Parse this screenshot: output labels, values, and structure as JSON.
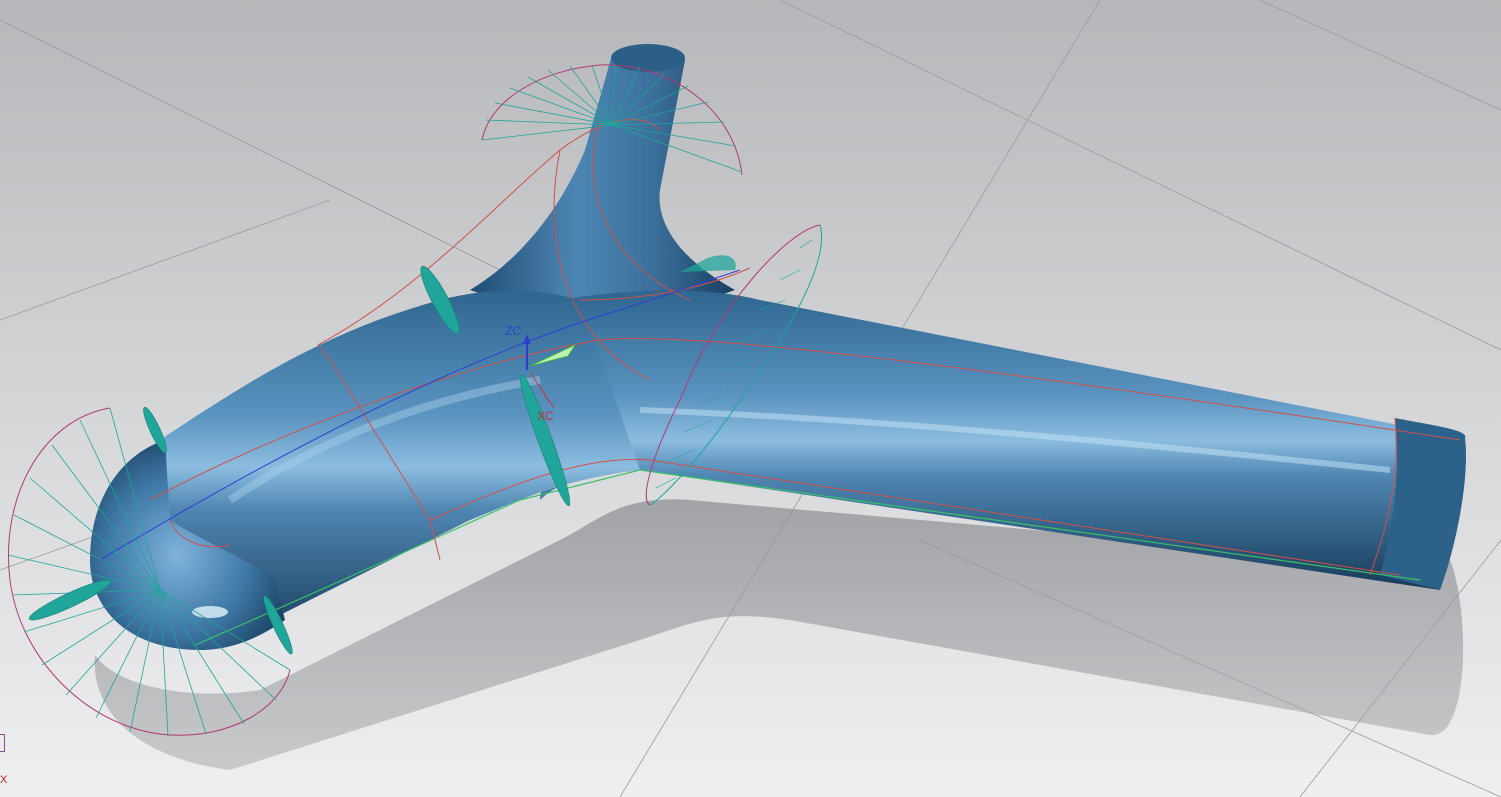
{
  "viewport": {
    "wcs_axes": {
      "zc_label": "ZC",
      "xc_label": "XC",
      "zc_color": "#2a3fd0",
      "xc_color": "#d02a3a",
      "yc_color": "#3bbf3b"
    },
    "view_triad": {
      "x_label": "X"
    },
    "colors": {
      "background_top": "#b9babd",
      "background_bottom": "#eeeeef",
      "body_dark": "#1e4a6e",
      "body_mid": "#3f78a6",
      "body_light": "#8fc0e3",
      "curve": "#d0504a",
      "sweep_lines": "#1fa59a",
      "sweep_outline": "#b03a70",
      "grid": "#9a9aa0"
    }
  }
}
